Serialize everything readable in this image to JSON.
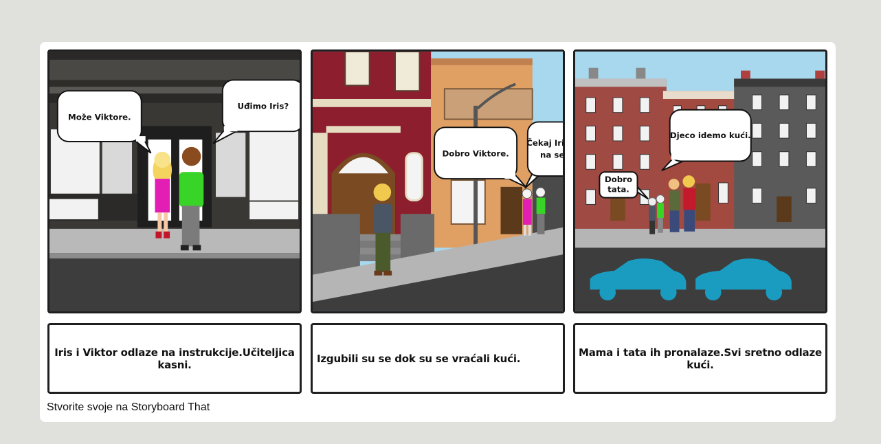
{
  "panels": [
    {
      "bubbles": [
        {
          "lines": [
            "Može Viktore."
          ]
        },
        {
          "lines": [
            "Uđimo Iris?"
          ]
        }
      ],
      "caption": "Iris i Viktor odlaze na instrukcije.Učiteljica kasni."
    },
    {
      "bubbles": [
        {
          "lines": [
            "Dobro Viktore."
          ]
        },
        {
          "lines": [
            "Čekaj Iris crveno je",
            "na semaforu."
          ]
        }
      ],
      "caption": "Izgubili su se dok su se vraćali kući."
    },
    {
      "bubbles": [
        {
          "lines": [
            "Dobro",
            "tata."
          ]
        },
        {
          "lines": [
            "Djeco idemo kući."
          ]
        }
      ],
      "caption": "Mama i tata ih pronalaze.Svi sretno odlaze kući."
    }
  ],
  "footer": "Stvorite svoje na Storyboard That",
  "colors": {
    "background": "#e0e1dd",
    "car": "#1a9cc0",
    "iris_dress": "#e21eb4",
    "viktor_shirt": "#39d428"
  }
}
